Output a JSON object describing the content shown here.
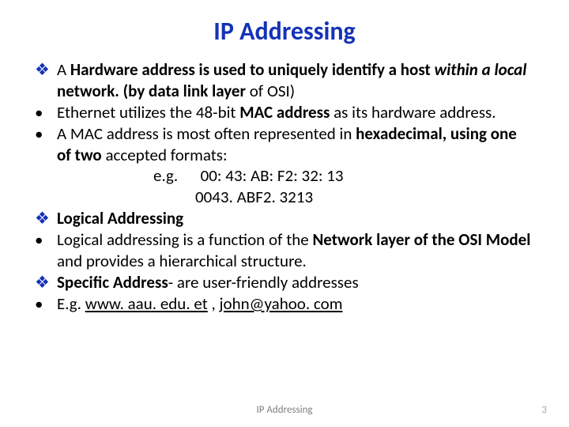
{
  "title": "IP Addressing",
  "b1": {
    "mark": "❖",
    "pre": "A ",
    "hw": "Hardware address ",
    "mid": "is used to uniquely identify a host ",
    "within": "within a local ",
    "net": "network. (by data link layer ",
    "end": "of OSI)"
  },
  "b2": {
    "mark": "•",
    "pre": "Ethernet utilizes the 48-bit ",
    "mac": "MAC address ",
    "end": "as its hardware address."
  },
  "b3": {
    "mark": "•",
    "pre": "A MAC address is most often represented in ",
    "hex": "hexadecimal, using one of two ",
    "end": "accepted formats:"
  },
  "b3a": "e.g.      00: 43: AB: F2: 32: 13",
  "b3b": "0043. ABF2. 3213",
  "b4": {
    "mark": "❖",
    "text": "Logical Addressing"
  },
  "b5": {
    "mark": "•",
    "pre": "Logical addressing is a function of the ",
    "nl": "Network layer of the OSI Model ",
    "end": "and provides a hierarchical structure."
  },
  "b6": {
    "mark": "❖",
    "sa": "Specific Address",
    "end": "- are user-friendly addresses"
  },
  "b7": {
    "mark": "•",
    "eg": "E.g. ",
    "link1": "www. aau. edu. et",
    "sep": " , ",
    "link2": "john@yahoo. com"
  },
  "footer": "IP Addressing",
  "page": "3"
}
